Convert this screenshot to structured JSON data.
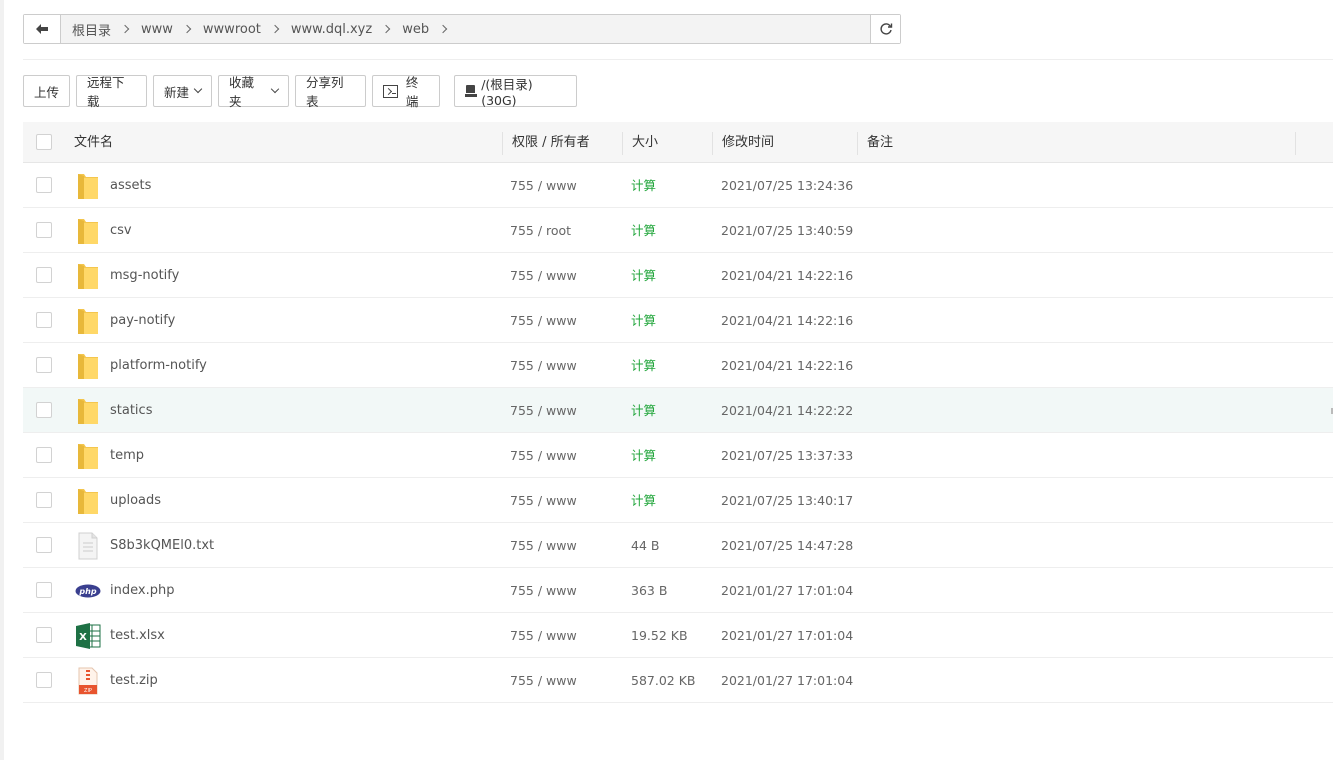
{
  "path": {
    "crumbs": [
      "根目录",
      "www",
      "wwwroot",
      "www.dql.xyz",
      "web"
    ]
  },
  "toolbar": {
    "upload": "上传",
    "remote_download": "远程下载",
    "new": "新建",
    "favorites": "收藏夹",
    "share_list": "分享列表",
    "terminal": "终端",
    "disk": "/(根目录) (30G)"
  },
  "table": {
    "headers": {
      "name": "文件名",
      "perm": "权限 / 所有者",
      "size": "大小",
      "mtime": "修改时间",
      "remark": "备注"
    },
    "rows": [
      {
        "type": "folder",
        "name": "assets",
        "perm": "755 / www",
        "size": "计算",
        "mtime": "2021/07/25 13:24:36"
      },
      {
        "type": "folder",
        "name": "csv",
        "perm": "755 / root",
        "size": "计算",
        "mtime": "2021/07/25 13:40:59"
      },
      {
        "type": "folder",
        "name": "msg-notify",
        "perm": "755 / www",
        "size": "计算",
        "mtime": "2021/04/21 14:22:16"
      },
      {
        "type": "folder",
        "name": "pay-notify",
        "perm": "755 / www",
        "size": "计算",
        "mtime": "2021/04/21 14:22:16"
      },
      {
        "type": "folder",
        "name": "platform-notify",
        "perm": "755 / www",
        "size": "计算",
        "mtime": "2021/04/21 14:22:16"
      },
      {
        "type": "folder",
        "name": "statics",
        "perm": "755 / www",
        "size": "计算",
        "mtime": "2021/04/21 14:22:22"
      },
      {
        "type": "folder",
        "name": "temp",
        "perm": "755 / www",
        "size": "计算",
        "mtime": "2021/07/25 13:37:33"
      },
      {
        "type": "folder",
        "name": "uploads",
        "perm": "755 / www",
        "size": "计算",
        "mtime": "2021/07/25 13:40:17"
      },
      {
        "type": "txt",
        "name": "S8b3kQMEl0.txt",
        "perm": "755 / www",
        "size": "44 B",
        "mtime": "2021/07/25 14:47:28"
      },
      {
        "type": "php",
        "name": "index.php",
        "perm": "755 / www",
        "size": "363 B",
        "mtime": "2021/01/27 17:01:04"
      },
      {
        "type": "xlsx",
        "name": "test.xlsx",
        "perm": "755 / www",
        "size": "19.52 KB",
        "mtime": "2021/01/27 17:01:04"
      },
      {
        "type": "zip",
        "name": "test.zip",
        "perm": "755 / www",
        "size": "587.02 KB",
        "mtime": "2021/01/27 17:01:04"
      }
    ]
  },
  "colors": {
    "calc_green": "#20a53a",
    "highlight_row": "#f2f8f7",
    "folder_yellow": "#ffd868"
  }
}
